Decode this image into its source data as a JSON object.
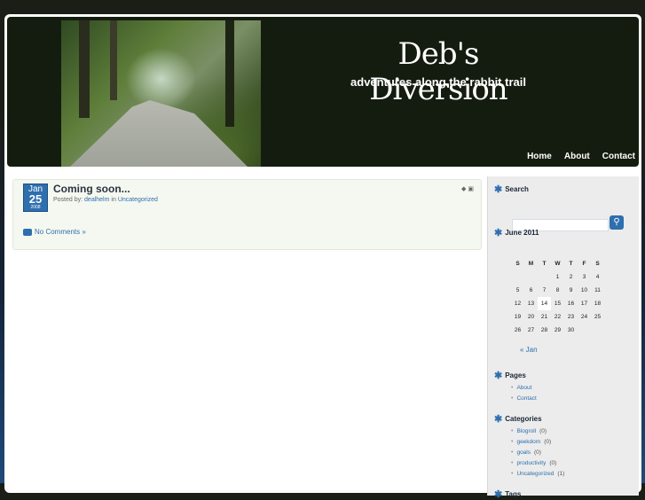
{
  "site": {
    "title": "Deb's Diversion",
    "tagline": "adventures along the rabbit trail"
  },
  "nav": {
    "items": [
      "Home",
      "About",
      "Contact"
    ]
  },
  "post": {
    "date": {
      "month": "Jan",
      "day": "25",
      "year": "2008"
    },
    "title": "Coming soon...",
    "meta_prefix": "Posted by:",
    "author": "dealhelm",
    "meta_in": "in",
    "category": "Uncategorized",
    "comments": "No Comments »"
  },
  "sidebar": {
    "search": {
      "title": "Search",
      "button_icon": "search-icon"
    },
    "calendar": {
      "title": "June 2011",
      "headers": [
        "S",
        "M",
        "T",
        "W",
        "T",
        "F",
        "S"
      ],
      "rows": [
        [
          "",
          "",
          "",
          "1",
          "2",
          "3",
          "4"
        ],
        [
          "5",
          "6",
          "7",
          "8",
          "9",
          "10",
          "11"
        ],
        [
          "12",
          "13",
          "14",
          "15",
          "16",
          "17",
          "18"
        ],
        [
          "19",
          "20",
          "21",
          "22",
          "23",
          "24",
          "25"
        ],
        [
          "26",
          "27",
          "28",
          "29",
          "30",
          "",
          ""
        ]
      ],
      "today": "14",
      "prev_link": "« Jan"
    },
    "pages": {
      "title": "Pages",
      "items": [
        "About",
        "Contact"
      ]
    },
    "categories": {
      "title": "Categories",
      "items": [
        {
          "name": "Blogroll",
          "count": "(0)"
        },
        {
          "name": "geekdom",
          "count": "(0)"
        },
        {
          "name": "goals",
          "count": "(0)"
        },
        {
          "name": "productivity",
          "count": "(0)"
        },
        {
          "name": "Uncategorized",
          "count": "(1)"
        }
      ]
    },
    "tags": {
      "title": "Tags"
    }
  },
  "colors": {
    "accent": "#2e6fae",
    "header_bg": "#141c0f",
    "sidebar_bg": "#ececec"
  }
}
